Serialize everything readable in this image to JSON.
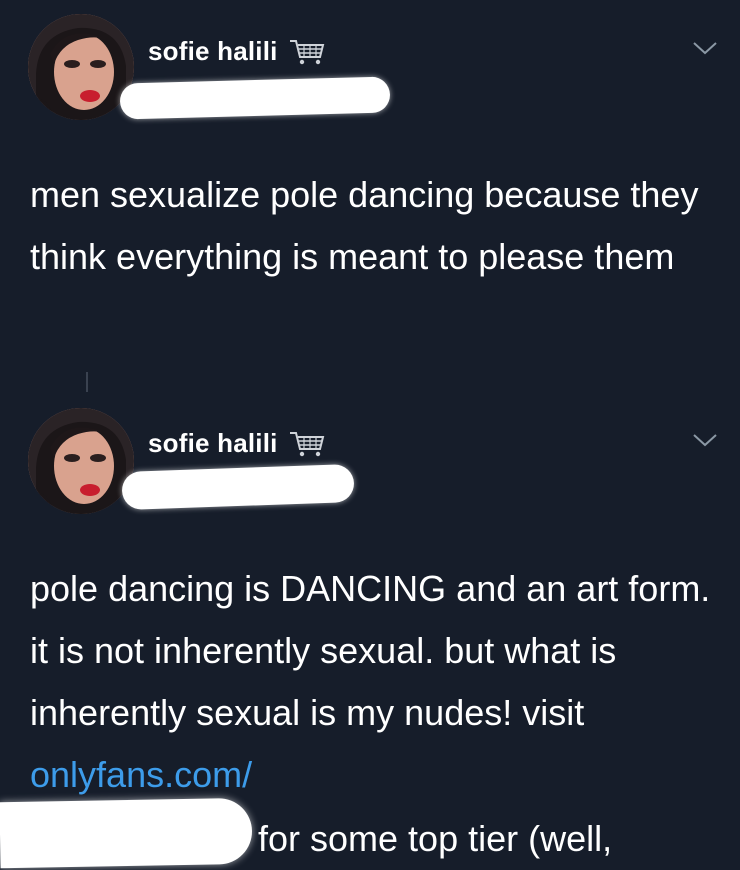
{
  "tweets": [
    {
      "display_name": "sofie halili",
      "badge_icon": "shopping-cart-icon",
      "text": "men sexualize pole dancing because they think everything is meant to please them"
    },
    {
      "display_name": "sofie halili",
      "badge_icon": "shopping-cart-icon",
      "text_before_link": "pole dancing is DANCING and an art form. it is not inherently sexual. but what is inherently sexual is my nudes! visit ",
      "link_text": "onlyfans.com/",
      "text_after_redaction": "for some top tier (well,"
    }
  ],
  "colors": {
    "background": "#161d2a",
    "text": "#ffffff",
    "link": "#3d9cea",
    "redaction": "#ffffff"
  }
}
